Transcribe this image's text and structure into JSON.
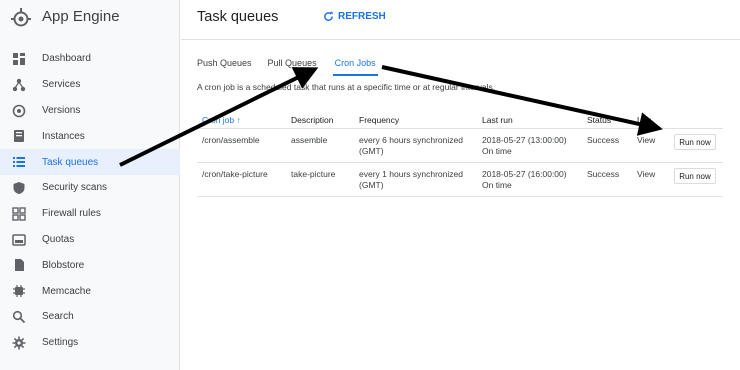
{
  "app": {
    "name": "App Engine"
  },
  "sidebar": {
    "items": [
      {
        "label": "Dashboard",
        "icon": "dashboard-icon"
      },
      {
        "label": "Services",
        "icon": "services-icon"
      },
      {
        "label": "Versions",
        "icon": "versions-icon"
      },
      {
        "label": "Instances",
        "icon": "instances-icon"
      },
      {
        "label": "Task queues",
        "icon": "task-queues-icon",
        "active": true
      },
      {
        "label": "Security scans",
        "icon": "shield-icon"
      },
      {
        "label": "Firewall rules",
        "icon": "firewall-icon"
      },
      {
        "label": "Quotas",
        "icon": "quotas-icon"
      },
      {
        "label": "Blobstore",
        "icon": "blobstore-icon"
      },
      {
        "label": "Memcache",
        "icon": "memcache-icon"
      },
      {
        "label": "Search",
        "icon": "search-icon"
      },
      {
        "label": "Settings",
        "icon": "gear-icon"
      }
    ]
  },
  "header": {
    "title": "Task queues",
    "refresh_label": "REFRESH"
  },
  "tabs": [
    {
      "label": "Push Queues"
    },
    {
      "label": "Pull Queues"
    },
    {
      "label": "Cron Jobs",
      "active": true
    }
  ],
  "description": "A cron job is a scheduled task that runs at a specific time or at regular intervals.",
  "table": {
    "columns": [
      "Cron job",
      "Description",
      "Frequency",
      "Last run",
      "Status",
      "Log"
    ],
    "rows": [
      {
        "cron_job": "/cron/assemble",
        "description": "assemble",
        "frequency_1": "every 6 hours synchronized",
        "frequency_2": "(GMT)",
        "last_run": "2018-05-27 (13:00:00)",
        "last_run_status": "On time",
        "status": "Success",
        "log": "View",
        "action": "Run now"
      },
      {
        "cron_job": "/cron/take-picture",
        "description": "take-picture",
        "frequency_1": "every 1 hours synchronized",
        "frequency_2": "(GMT)",
        "last_run": "2018-05-27 (16:00:00)",
        "last_run_status": "On time",
        "status": "Success",
        "log": "View",
        "action": "Run now"
      }
    ]
  },
  "colors": {
    "accent": "#1a73e8",
    "active_bg": "#e8f0fe",
    "arrow": "#000000"
  }
}
